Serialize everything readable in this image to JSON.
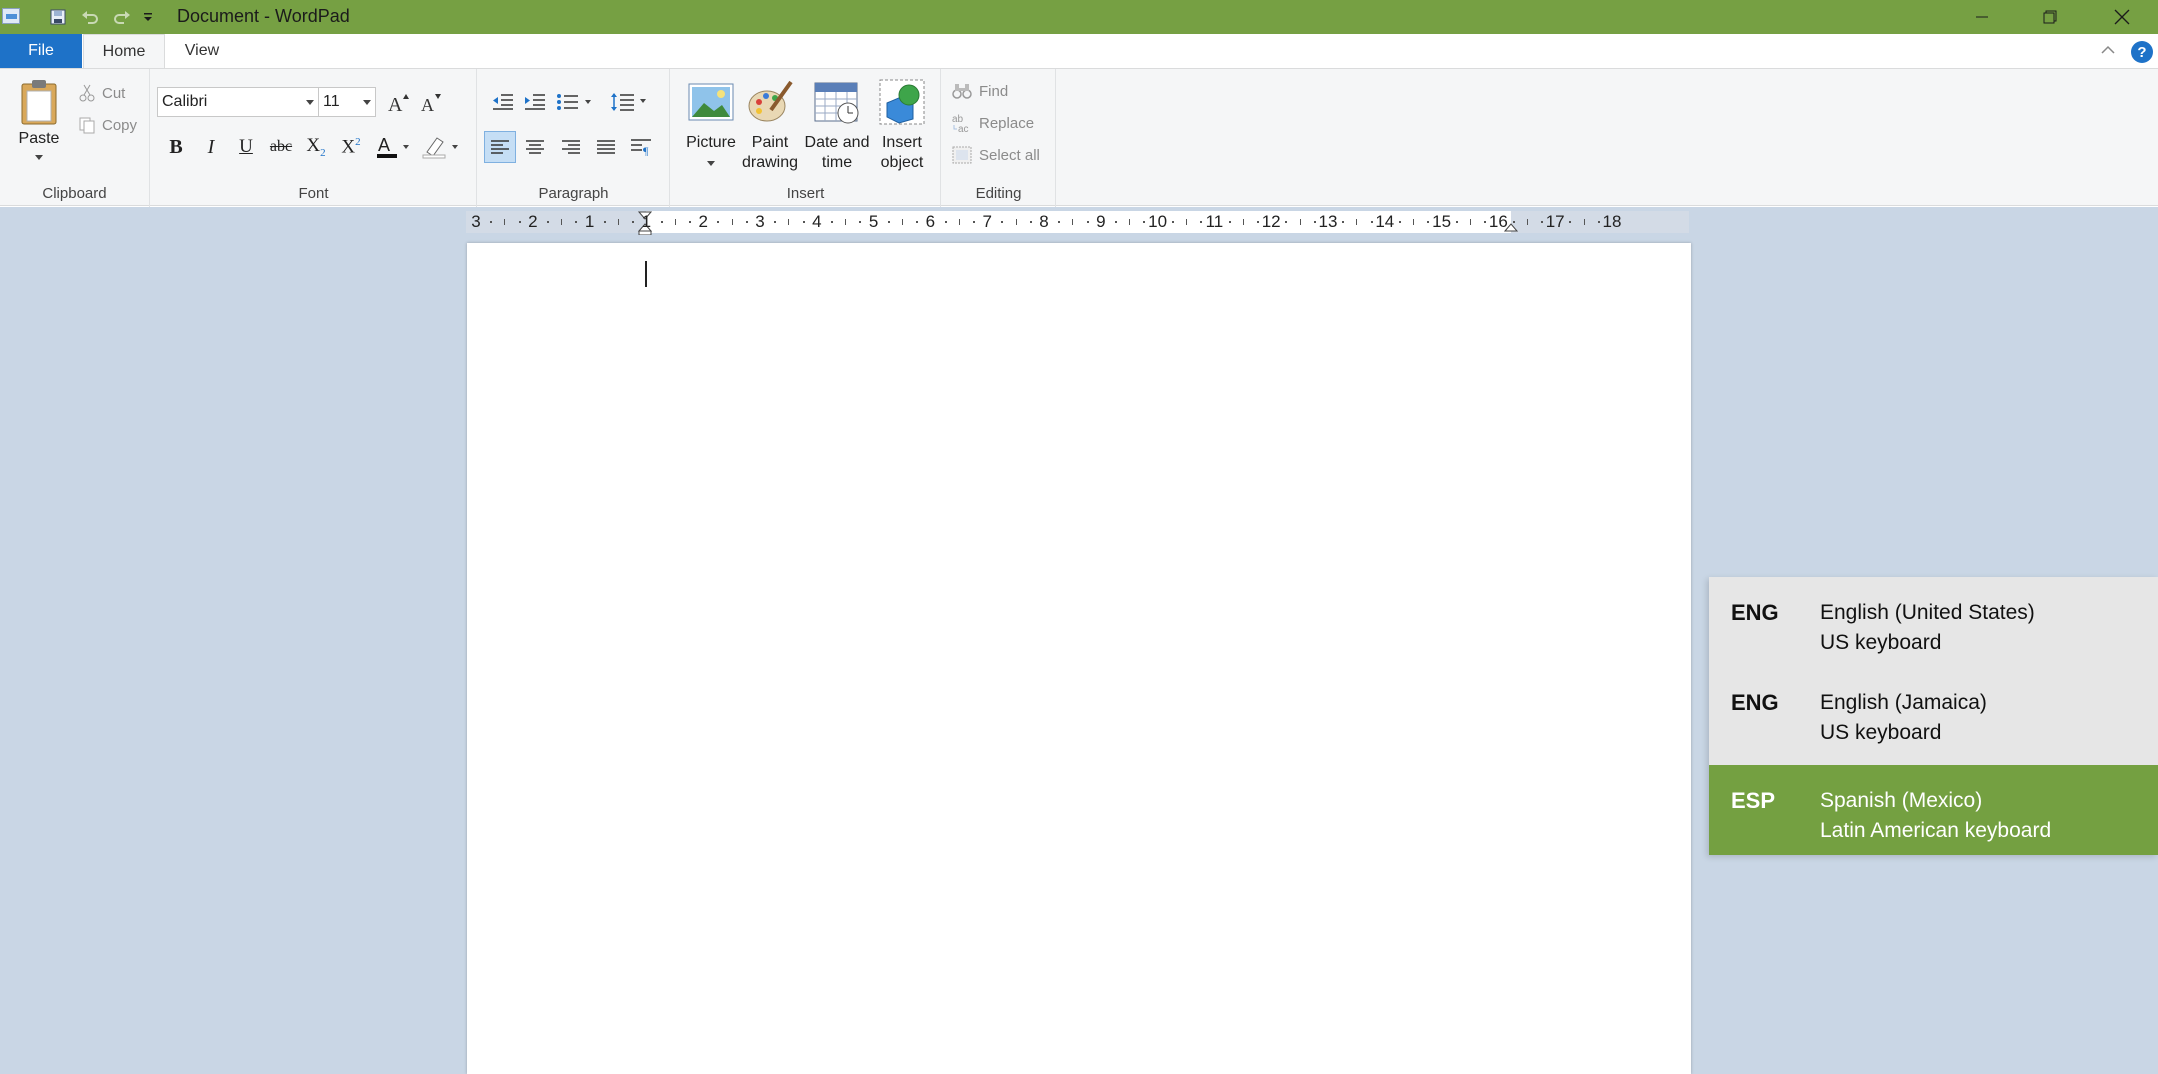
{
  "window": {
    "title": "Document - WordPad",
    "accent_color": "#76a043"
  },
  "tabs": [
    {
      "label": "File"
    },
    {
      "label": "Home"
    },
    {
      "label": "View"
    }
  ],
  "ribbon": {
    "clipboard": {
      "label": "Clipboard",
      "paste": "Paste",
      "cut": "Cut",
      "copy": "Copy"
    },
    "font": {
      "label": "Font",
      "family": "Calibri",
      "size": "11"
    },
    "paragraph": {
      "label": "Paragraph"
    },
    "insert": {
      "label": "Insert",
      "picture": "Picture",
      "paint_line1": "Paint",
      "paint_line2": "drawing",
      "datetime_line1": "Date and",
      "datetime_line2": "time",
      "object_line1": "Insert",
      "object_line2": "object"
    },
    "editing": {
      "label": "Editing",
      "find": "Find",
      "replace": "Replace",
      "select_all": "Select all"
    }
  },
  "ruler": {
    "labels": [
      "3",
      "2",
      "1",
      "1",
      "2",
      "3",
      "4",
      "5",
      "6",
      "7",
      "8",
      "9",
      "10",
      "11",
      "12",
      "13",
      "14",
      "15",
      "16",
      "17",
      "18"
    ]
  },
  "language_switcher": {
    "items": [
      {
        "code": "ENG",
        "language": "English (United States)",
        "keyboard": "US keyboard",
        "selected": false
      },
      {
        "code": "ENG",
        "language": "English (Jamaica)",
        "keyboard": "US keyboard",
        "selected": false
      },
      {
        "code": "ESP",
        "language": "Spanish (Mexico)",
        "keyboard": "Latin American keyboard",
        "selected": true
      }
    ]
  }
}
